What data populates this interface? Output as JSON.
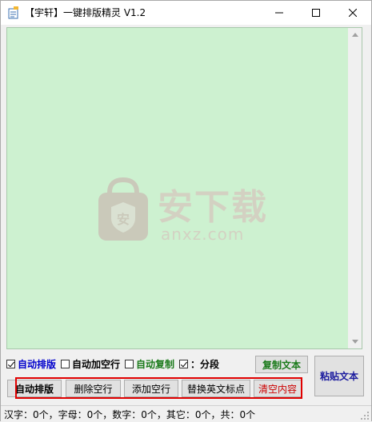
{
  "window": {
    "title": "【宇轩】一键排版精灵 V1.2"
  },
  "editor": {
    "watermark_title": "安下载",
    "watermark_sub": "anxz.com"
  },
  "options": [
    {
      "label": "自动排版",
      "checked": true,
      "color": "#0000cc"
    },
    {
      "label": "自动加空行",
      "checked": false,
      "color": "#000000"
    },
    {
      "label": "自动复制",
      "checked": false,
      "color": "#1a7a1a"
    },
    {
      "label": "：分段",
      "checked": true,
      "color": "#000000"
    }
  ],
  "buttons": {
    "copy_text": "复制文本",
    "paste_text": "粘贴文本",
    "auto_format": "自动排版",
    "delete_empty_lines": "删除空行",
    "add_empty_lines": "添加空行",
    "replace_punctuation": "替换英文标点",
    "clear_content": "清空内容"
  },
  "status": {
    "text": "汉字：0个，字母：0个，数字：0个，其它：0个，共：0个"
  },
  "colors": {
    "editor_bg": "#cdf1d0",
    "highlight_frame": "#e00000",
    "clear_button_text": "#cc0000"
  }
}
